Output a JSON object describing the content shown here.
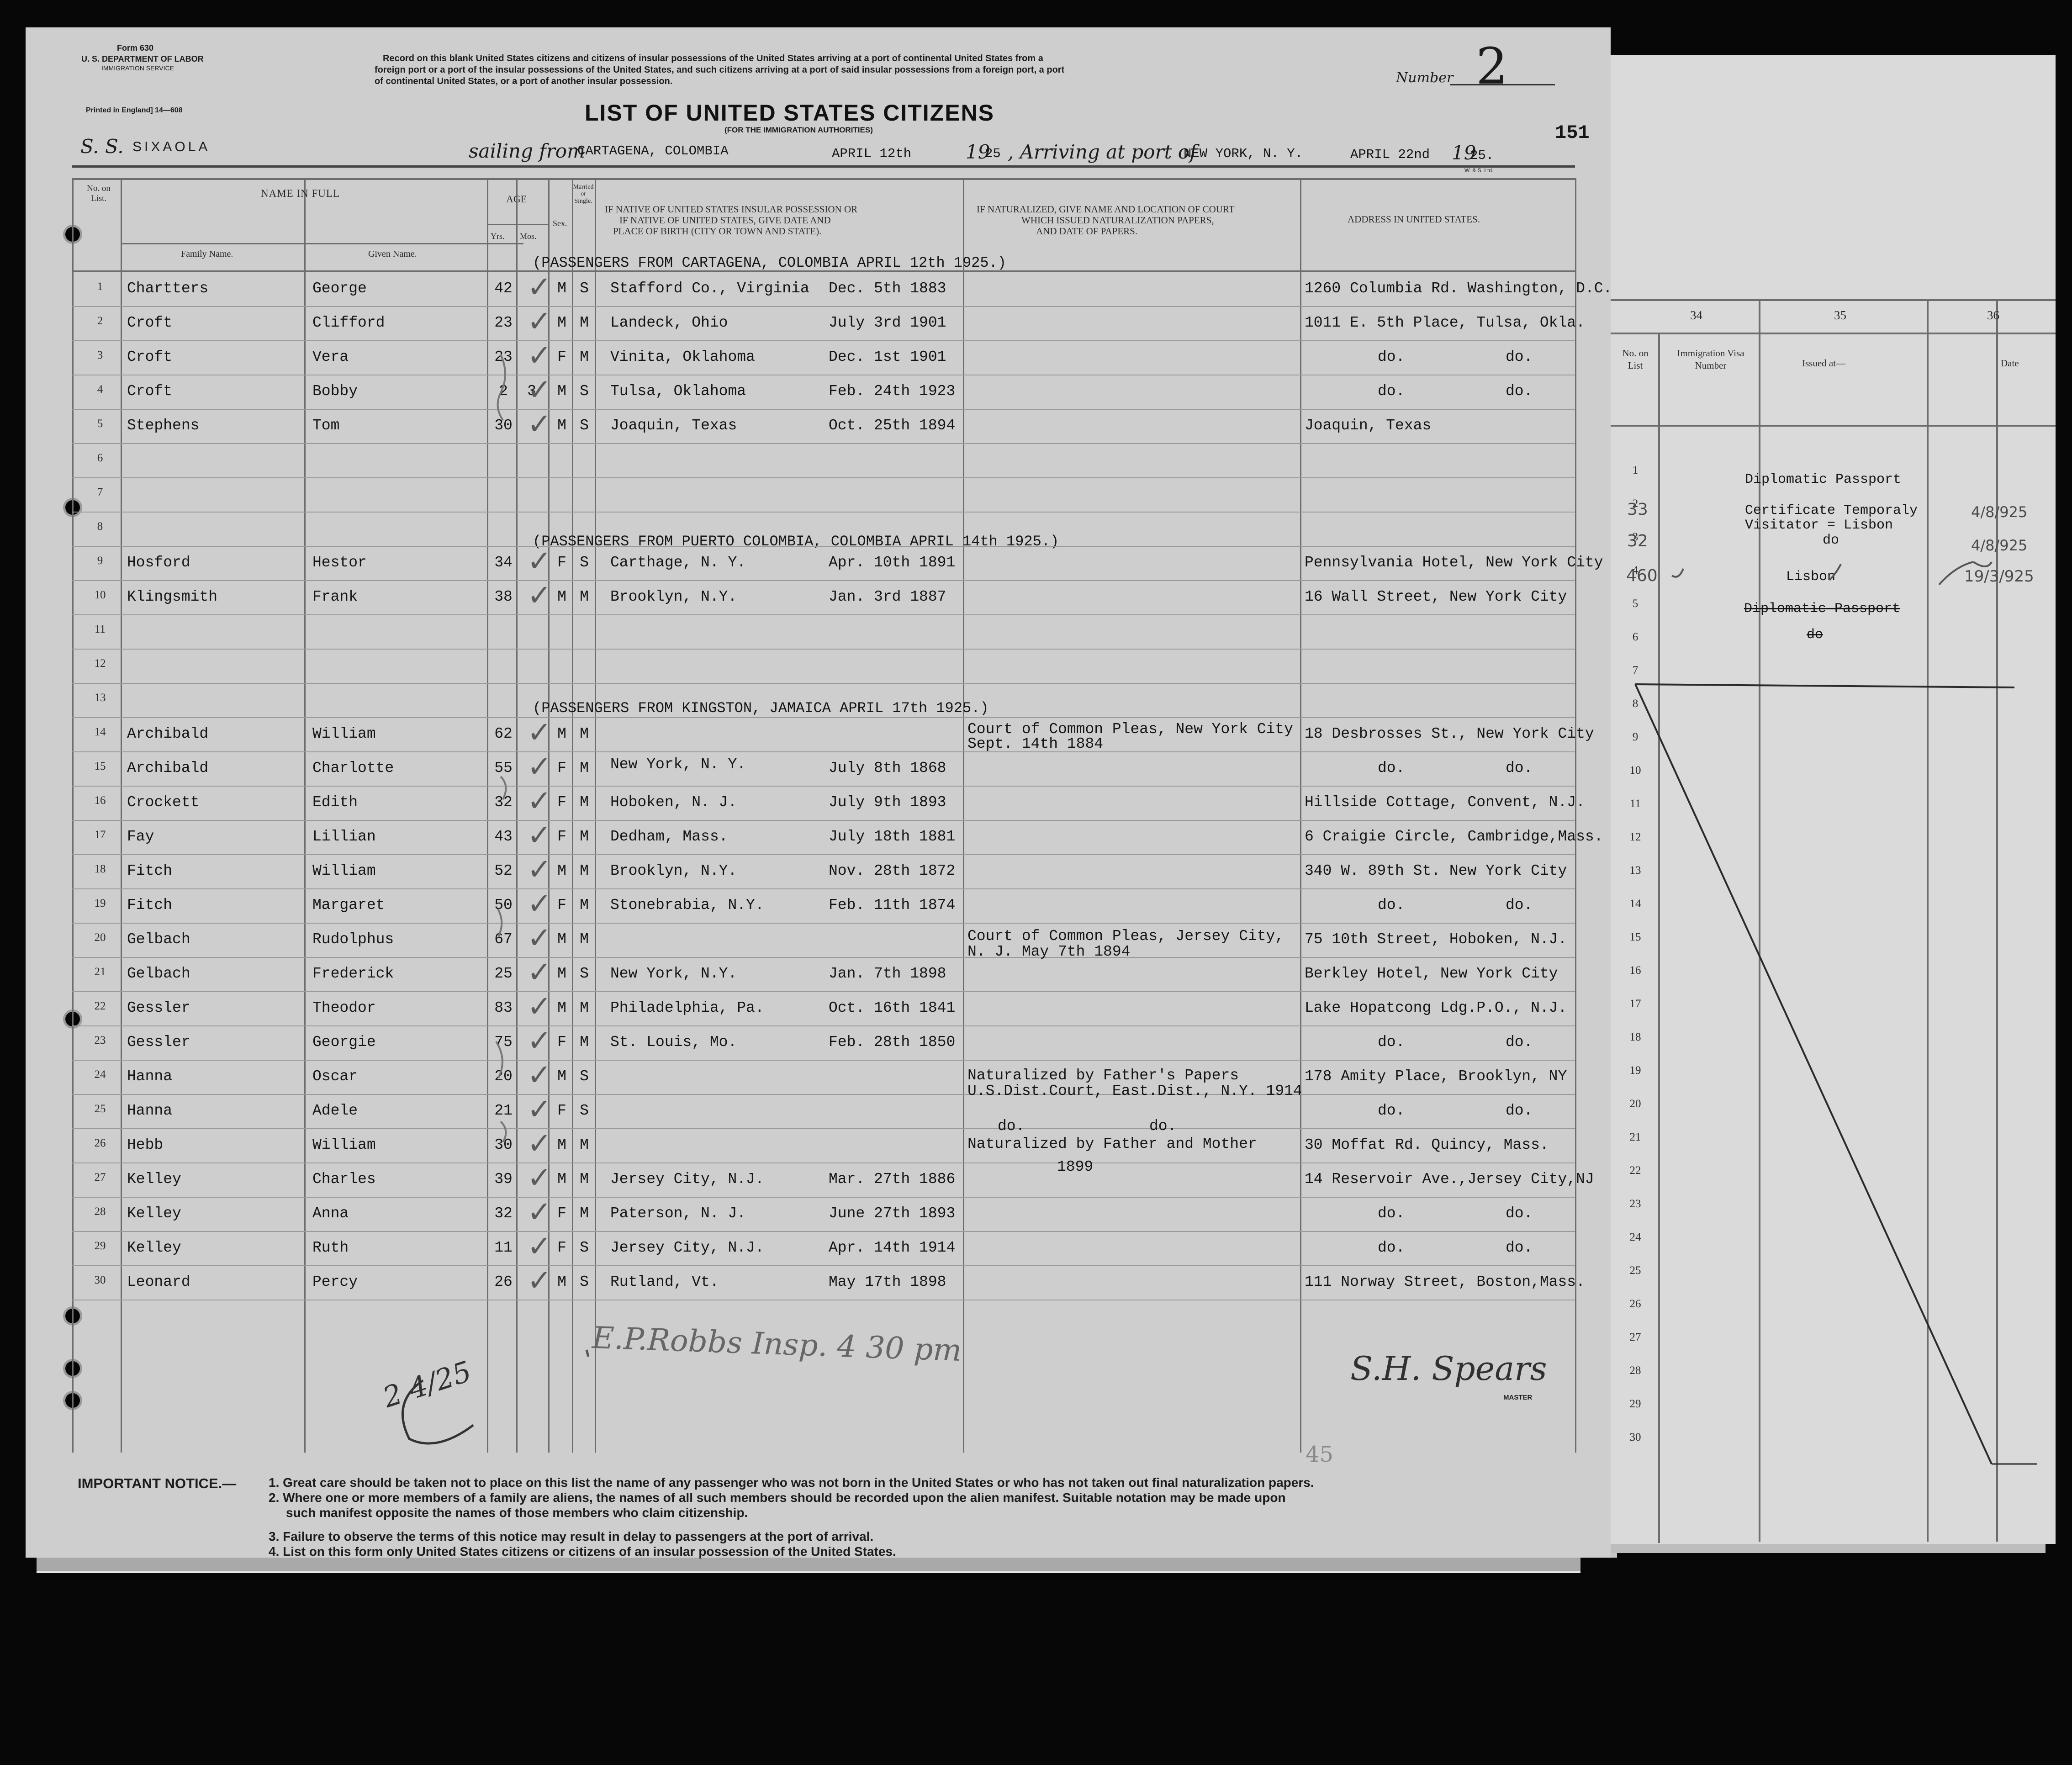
{
  "form": {
    "form_number": "Form 630",
    "department": "U. S. DEPARTMENT OF LABOR",
    "service": "IMMIGRATION SERVICE",
    "printed": "Printed in England] 14—608",
    "instructions": [
      "Record on this blank United States citizens and citizens of insular possessions of the United States arriving at a port of continental United States from a",
      "foreign port or a port of the insular possessions of the United States, and such citizens arriving at a port of said insular possessions from a foreign port, a port",
      "of continental United States, or a port of another insular possession."
    ],
    "number_label": "Number",
    "number_value": "2",
    "title": "LIST OF UNITED STATES CITIZENS",
    "subtitle": "(FOR THE IMMIGRATION AUTHORITIES)",
    "page_number": "151",
    "ss_prefix": "S. S.",
    "ship": "SIXAOLA",
    "sailing_from_label": "sailing from",
    "sailing_from": "CARTAGENA, COLOMBIA",
    "sail_date": "APRIL 12th",
    "year_prefix": "19",
    "year1": "25",
    "arriving_label": ", Arriving at port of",
    "arrival_port": "NEW YORK, N. Y.",
    "arrival_date": "APRIL 22nd",
    "year2": "25.",
    "printer": "W. & S. Ltd."
  },
  "headers": {
    "no_on_list": "No. on List.",
    "name_in_full": "NAME IN FULL",
    "family_name": "Family Name.",
    "given_name": "Given Name.",
    "age": "AGE",
    "yrs": "Yrs.",
    "mos": "Mos.",
    "sex": "Sex.",
    "married": "Married or Single.",
    "birth": [
      "IF NATIVE OF UNITED STATES INSULAR POSSESSION OR",
      "IF NATIVE OF UNITED STATES, GIVE DATE AND",
      "PLACE OF BIRTH (CITY OR TOWN AND STATE)."
    ],
    "naturalized": [
      "IF NATURALIZED, GIVE NAME AND LOCATION OF COURT",
      "WHICH ISSUED NATURALIZATION PAPERS,",
      "AND DATE OF PAPERS."
    ],
    "address": "ADDRESS IN UNITED STATES."
  },
  "section_headers": [
    {
      "row": 1,
      "text": "(PASSENGERS FROM CARTAGENA, COLOMBIA  APRIL 12th 1925.)"
    },
    {
      "row": 8,
      "text": "(PASSENGERS FROM PUERTO COLOMBIA, COLOMBIA APRIL 14th 1925.)"
    },
    {
      "row": 13,
      "text": "(PASSENGERS FROM KINGSTON, JAMAICA  APRIL 17th 1925.)"
    }
  ],
  "rows": [
    {
      "no": "1",
      "family": "Chartters",
      "given": "George",
      "yrs": "42",
      "mos": "",
      "sex": "M",
      "ms": "S",
      "place": "Stafford Co., Virginia",
      "date": "Dec. 5th 1883",
      "addr1": "1260 Columbia Rd. Washington, D.C.",
      "addr2": ""
    },
    {
      "no": "2",
      "family": "Croft",
      "given": "Clifford",
      "yrs": "23",
      "mos": "",
      "sex": "M",
      "ms": "M",
      "place": "Landeck, Ohio",
      "date": "July 3rd 1901",
      "addr1": "1011 E. 5th Place, Tulsa, Okla.",
      "addr2": ""
    },
    {
      "no": "3",
      "family": "Croft",
      "given": "Vera",
      "yrs": "23",
      "mos": "",
      "sex": "F",
      "ms": "M",
      "place": "Vinita, Oklahoma",
      "date": "Dec. 1st 1901",
      "addr1": "do.",
      "addr2": "do."
    },
    {
      "no": "4",
      "family": "Croft",
      "given": "Bobby",
      "yrs": "2",
      "mos": "3",
      "sex": "M",
      "ms": "S",
      "place": "Tulsa, Oklahoma",
      "date": "Feb. 24th 1923",
      "addr1": "do.",
      "addr2": "do."
    },
    {
      "no": "5",
      "family": "Stephens",
      "given": "Tom",
      "yrs": "30",
      "mos": "",
      "sex": "M",
      "ms": "S",
      "place": "Joaquin, Texas",
      "date": "Oct. 25th 1894",
      "addr1": "Joaquin, Texas",
      "addr2": ""
    },
    {
      "no": "6",
      "family": "",
      "given": "",
      "yrs": "",
      "mos": "",
      "sex": "",
      "ms": "",
      "place": "",
      "date": "",
      "addr1": "",
      "addr2": ""
    },
    {
      "no": "7",
      "family": "",
      "given": "",
      "yrs": "",
      "mos": "",
      "sex": "",
      "ms": "",
      "place": "",
      "date": "",
      "addr1": "",
      "addr2": ""
    },
    {
      "no": "8",
      "family": "",
      "given": "",
      "yrs": "",
      "mos": "",
      "sex": "",
      "ms": "",
      "place": "",
      "date": "",
      "addr1": "",
      "addr2": ""
    },
    {
      "no": "9",
      "family": "Hosford",
      "given": "Hestor",
      "yrs": "34",
      "mos": "",
      "sex": "F",
      "ms": "S",
      "place": "Carthage, N. Y.",
      "date": "Apr. 10th 1891",
      "addr1": "Pennsylvania Hotel, New York City",
      "addr2": ""
    },
    {
      "no": "10",
      "family": "Klingsmith",
      "given": "Frank",
      "yrs": "38",
      "mos": "",
      "sex": "M",
      "ms": "M",
      "place": "Brooklyn, N.Y.",
      "date": "Jan. 3rd 1887",
      "addr1": "16 Wall Street, New York City",
      "addr2": ""
    },
    {
      "no": "11",
      "family": "",
      "given": "",
      "yrs": "",
      "mos": "",
      "sex": "",
      "ms": "",
      "place": "",
      "date": "",
      "addr1": "",
      "addr2": ""
    },
    {
      "no": "12",
      "family": "",
      "given": "",
      "yrs": "",
      "mos": "",
      "sex": "",
      "ms": "",
      "place": "",
      "date": "",
      "addr1": "",
      "addr2": ""
    },
    {
      "no": "13",
      "family": "",
      "given": "",
      "yrs": "",
      "mos": "",
      "sex": "",
      "ms": "",
      "place": "",
      "date": "",
      "addr1": "",
      "addr2": ""
    },
    {
      "no": "14",
      "family": "Archibald",
      "given": "William",
      "yrs": "62",
      "mos": "",
      "sex": "M",
      "ms": "M",
      "place": "",
      "date": "",
      "addr1": "18 Desbrosses St., New York City",
      "addr2": ""
    },
    {
      "no": "15",
      "family": "Archibald",
      "given": "Charlotte",
      "yrs": "55",
      "mos": "",
      "sex": "F",
      "ms": "M",
      "place": "",
      "date": "July 8th 1868",
      "addr1": "do.",
      "addr2": "do."
    },
    {
      "no": "16",
      "family": "Crockett",
      "given": "Edith",
      "yrs": "32",
      "mos": "",
      "sex": "F",
      "ms": "M",
      "place": "Hoboken, N. J.",
      "date": "July 9th 1893",
      "addr1": "Hillside Cottage, Convent, N.J.",
      "addr2": ""
    },
    {
      "no": "17",
      "family": "Fay",
      "given": "Lillian",
      "yrs": "43",
      "mos": "",
      "sex": "F",
      "ms": "M",
      "place": "Dedham, Mass.",
      "date": "July 18th 1881",
      "addr1": "6 Craigie Circle, Cambridge,Mass.",
      "addr2": ""
    },
    {
      "no": "18",
      "family": "Fitch",
      "given": "William",
      "yrs": "52",
      "mos": "",
      "sex": "M",
      "ms": "M",
      "place": "Brooklyn, N.Y.",
      "date": "Nov. 28th 1872",
      "addr1": "340 W. 89th St. New York City",
      "addr2": ""
    },
    {
      "no": "19",
      "family": "Fitch",
      "given": "Margaret",
      "yrs": "50",
      "mos": "",
      "sex": "F",
      "ms": "M",
      "place": "Stonebrabia, N.Y.",
      "date": "Feb. 11th 1874",
      "addr1": "do.",
      "addr2": "do."
    },
    {
      "no": "20",
      "family": "Gelbach",
      "given": "Rudolphus",
      "yrs": "67",
      "mos": "",
      "sex": "M",
      "ms": "M",
      "place": "",
      "date": "",
      "addr1": "75 10th Street, Hoboken, N.J.",
      "addr2": ""
    },
    {
      "no": "21",
      "family": "Gelbach",
      "given": "Frederick",
      "yrs": "25",
      "mos": "",
      "sex": "M",
      "ms": "S",
      "place": "New York, N.Y.",
      "date": "Jan. 7th 1898",
      "addr1": "Berkley Hotel, New York City",
      "addr2": ""
    },
    {
      "no": "22",
      "family": "Gessler",
      "given": "Theodor",
      "yrs": "83",
      "mos": "",
      "sex": "M",
      "ms": "M",
      "place": "Philadelphia, Pa.",
      "date": "Oct. 16th 1841",
      "addr1": "Lake Hopatcong Ldg.P.O., N.J.",
      "addr2": ""
    },
    {
      "no": "23",
      "family": "Gessler",
      "given": "Georgie",
      "yrs": "75",
      "mos": "",
      "sex": "F",
      "ms": "M",
      "place": "St. Louis, Mo.",
      "date": "Feb. 28th 1850",
      "addr1": "do.",
      "addr2": "do."
    },
    {
      "no": "24",
      "family": "Hanna",
      "given": "Oscar",
      "yrs": "20",
      "mos": "",
      "sex": "M",
      "ms": "S",
      "place": "",
      "date": "",
      "addr1": "178 Amity Place, Brooklyn, NY",
      "addr2": ""
    },
    {
      "no": "25",
      "family": "Hanna",
      "given": "Adele",
      "yrs": "21",
      "mos": "",
      "sex": "F",
      "ms": "S",
      "place": "",
      "date": "",
      "addr1": "do.",
      "addr2": "do."
    },
    {
      "no": "26",
      "family": "Hebb",
      "given": "William",
      "yrs": "30",
      "mos": "",
      "sex": "M",
      "ms": "M",
      "place": "",
      "date": "",
      "addr1": "30 Moffat Rd. Quincy, Mass.",
      "addr2": ""
    },
    {
      "no": "27",
      "family": "Kelley",
      "given": "Charles",
      "yrs": "39",
      "mos": "",
      "sex": "M",
      "ms": "M",
      "place": "Jersey City, N.J.",
      "date": "Mar. 27th 1886",
      "addr1": "14 Reservoir Ave.,Jersey City,NJ",
      "addr2": ""
    },
    {
      "no": "28",
      "family": "Kelley",
      "given": "Anna",
      "yrs": "32",
      "mos": "",
      "sex": "F",
      "ms": "M",
      "place": "Paterson, N. J.",
      "date": "June 27th 1893",
      "addr1": "do.",
      "addr2": "do."
    },
    {
      "no": "29",
      "family": "Kelley",
      "given": "Ruth",
      "yrs": "11",
      "mos": "",
      "sex": "F",
      "ms": "S",
      "place": "Jersey City, N.J.",
      "date": "Apr. 14th 1914",
      "addr1": "do.",
      "addr2": "do."
    },
    {
      "no": "30",
      "family": "Leonard",
      "given": "Percy",
      "yrs": "26",
      "mos": "",
      "sex": "M",
      "ms": "S",
      "place": "Rutland, Vt.",
      "date": "May 17th 1898",
      "addr1": "111 Norway Street, Boston,Mass.",
      "addr2": ""
    }
  ],
  "extra_text": {
    "row14_place": "New York, N. Y.",
    "row14_court1": "Court of Common Pleas, New York City",
    "row14_court2": "Sept. 14th 1884",
    "row20_court1": "Court of Common Pleas, Jersey City,",
    "row20_court2": "N. J. May 7th 1894",
    "row24_nat1": "Naturalized by Father's Papers",
    "row24_nat2": "U.S.Dist.Court, East.Dist., N.Y. 1914",
    "row25_do1": "do.",
    "row25_do2": "do.",
    "row26_nat1": "Naturalized by Father and Mother",
    "row26_nat2": "1899"
  },
  "handwriting": {
    "inspector_note": "E.P.Robbs  Insp.  4 30 pm",
    "initials": "2 4/25",
    "master_signature": "S.H. Spears",
    "master_label": "MASTER",
    "stamp": "45"
  },
  "notice": {
    "label": "IMPORTANT NOTICE.—",
    "items": [
      "1. Great care should be taken not to place on this list the name of any passenger who was not born in the United States or who has not taken out final naturalization papers.",
      "2. Where one or more members of a family are aliens, the names of all such members should be recorded upon the alien manifest.  Suitable notation may be made upon",
      "such manifest opposite the names of those members who claim citizenship.",
      "3. Failure to observe the terms of this notice may result in delay to passengers at the port of arrival.",
      "4. List on this form only United States citizens or citizens of an insular possession of the United States."
    ]
  },
  "right_sheet": {
    "col_numbers": [
      "34",
      "35",
      "36"
    ],
    "headers": {
      "no_on_list": "No. on List",
      "visa": "Immigration Visa Number",
      "issued": "Issued at—",
      "date": "Date"
    },
    "row_numbers": [
      "1",
      "2",
      "3",
      "4",
      "5",
      "6",
      "7",
      "8",
      "9",
      "10",
      "11",
      "12",
      "13",
      "14",
      "15",
      "16",
      "17",
      "18",
      "19",
      "20",
      "21",
      "22",
      "23",
      "24",
      "25",
      "26",
      "27",
      "28",
      "29",
      "30"
    ],
    "entries": {
      "r1_issued": "Diplomatic Passport",
      "r2_visa": "33",
      "r2_issued": "Certificate Temporaly",
      "r2_issued_b": "Visitator = Lisbon",
      "r2_date": "4/8/925",
      "r3_visa": "32",
      "r3_issued": "do",
      "r3_date": "4/8/925",
      "r4_visa": "460",
      "r4_issued": "Lisbon",
      "r4_date": "19/3/925",
      "r5_issued": "Diplomatic Passport",
      "r6_issued": "do"
    }
  }
}
